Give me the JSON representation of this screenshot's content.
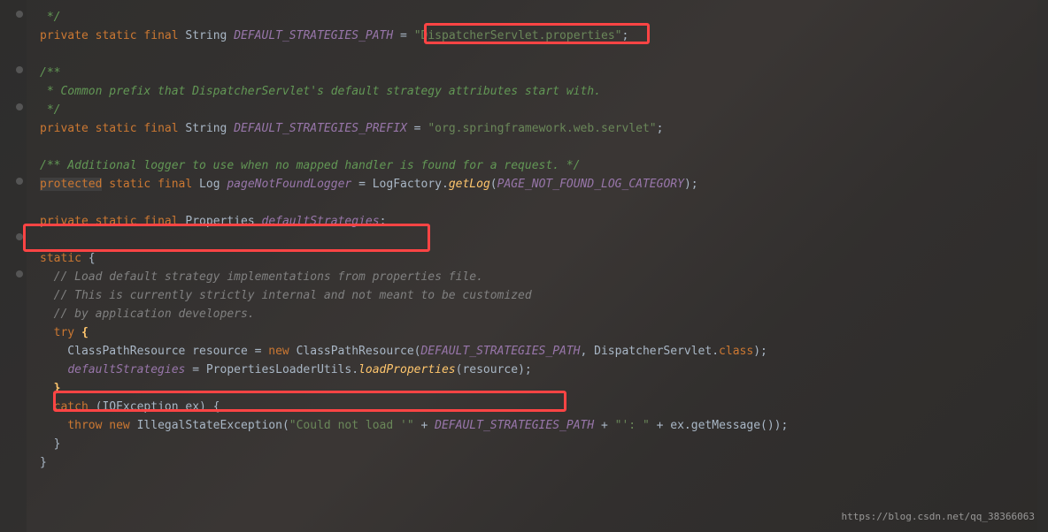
{
  "code": {
    "l1": " */",
    "l2a": "private",
    "l2b": "static",
    "l2c": "final",
    "l2d": "String",
    "l2e": "DEFAULT_STRATEGIES_PATH",
    "l2f": " = ",
    "l2g": "\"DispatcherServlet.properties\"",
    "l2h": ";",
    "l4a": "/**",
    "l5a": " * Common prefix that DispatcherServlet's default strategy attributes start with.",
    "l6a": " */",
    "l7a": "private",
    "l7b": "static",
    "l7c": "final",
    "l7d": "String",
    "l7e": "DEFAULT_STRATEGIES_PREFIX",
    "l7f": " = ",
    "l7g": "\"org.springframework.web.servlet\"",
    "l7h": ";",
    "l9a": "/** Additional logger to use when no mapped handler is found for a request. */",
    "l10a": "protected",
    "l10b": "static",
    "l10c": "final",
    "l10d": "Log",
    "l10e": "pageNotFoundLogger",
    "l10f": " = LogFactory.",
    "l10g": "getLog",
    "l10h": "(",
    "l10i": "PAGE_NOT_FOUND_LOG_CATEGORY",
    "l10j": ");",
    "l12a": "private",
    "l12b": "static",
    "l12c": "final",
    "l12d": "Properties",
    "l12e": "defaultStrategies",
    "l12f": ";",
    "l14a": "static",
    "l14b": " {",
    "l15a": "  // Load default strategy implementations from properties file.",
    "l16a": "  // This is currently strictly internal and not meant to be customized",
    "l17a": "  // by application developers.",
    "l18a": "  try",
    "l18b": " {",
    "l19a": "    ClassPathResource resource = ",
    "l19b": "new",
    "l19c": " ClassPathResource(",
    "l19d": "DEFAULT_STRATEGIES_PATH",
    "l19e": ", DispatcherServlet.",
    "l19f": "class",
    "l19g": ");",
    "l20a": "    ",
    "l20b": "defaultStrategies",
    "l20c": " = PropertiesLoaderUtils.",
    "l20d": "loadProperties",
    "l20e": "(resource);",
    "l21a": "  }",
    "l22a": "  catch",
    "l22b": " (IOException ex) {",
    "l23a": "    throw",
    "l23b": " new",
    "l23c": " IllegalStateException(",
    "l23d": "\"Could not load '\"",
    "l23e": " + ",
    "l23f": "DEFAULT_STRATEGIES_PATH",
    "l23g": " + ",
    "l23h": "\"': \"",
    "l23i": " + ex.getMessage());",
    "l24a": "  }",
    "l25a": "}"
  },
  "watermark": "https://blog.csdn.net/qq_38366063"
}
